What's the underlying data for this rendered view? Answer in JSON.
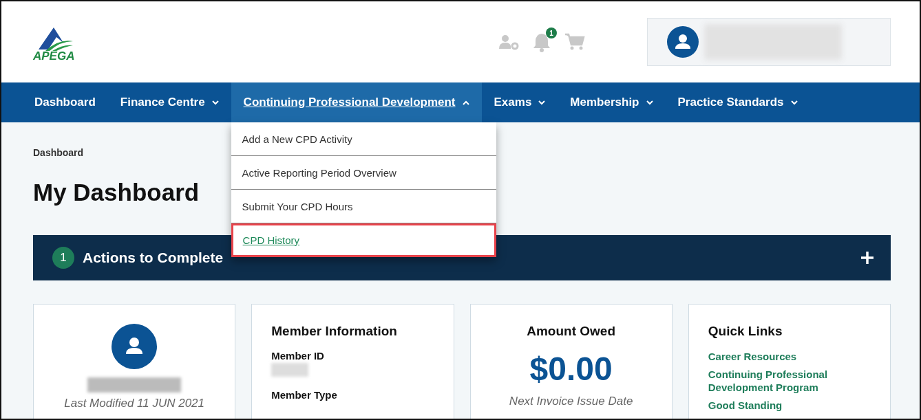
{
  "header": {
    "logo_text": "APEGA",
    "notification_count": "1"
  },
  "nav": [
    {
      "label": "Dashboard",
      "has_menu": false,
      "expanded": false
    },
    {
      "label": "Finance Centre",
      "has_menu": true,
      "expanded": false
    },
    {
      "label": "Continuing Professional Development",
      "has_menu": true,
      "expanded": true,
      "menu": [
        {
          "label": "Add a New CPD Activity",
          "highlighted": false
        },
        {
          "label": "Active Reporting Period Overview",
          "highlighted": false
        },
        {
          "label": "Submit Your CPD Hours",
          "highlighted": false
        },
        {
          "label": "CPD History",
          "highlighted": true
        }
      ]
    },
    {
      "label": "Exams",
      "has_menu": true,
      "expanded": false
    },
    {
      "label": "Membership",
      "has_menu": true,
      "expanded": false
    },
    {
      "label": "Practice Standards",
      "has_menu": true,
      "expanded": false
    }
  ],
  "breadcrumb": "Dashboard",
  "title": "My Dashboard",
  "actions": {
    "count": "1",
    "label": "Actions to Complete",
    "expanded": false
  },
  "profile_card": {
    "modified": "Last Modified 11 JUN 2021"
  },
  "member_card": {
    "title": "Member Information",
    "fields": [
      "Member ID",
      "Member Type"
    ]
  },
  "amount_card": {
    "title": "Amount Owed",
    "amount": "$0.00",
    "note": "Next Invoice Issue Date"
  },
  "links_card": {
    "title": "Quick Links",
    "links": [
      "Career Resources",
      "Continuing Professional Development Program",
      "Good Standing"
    ]
  }
}
